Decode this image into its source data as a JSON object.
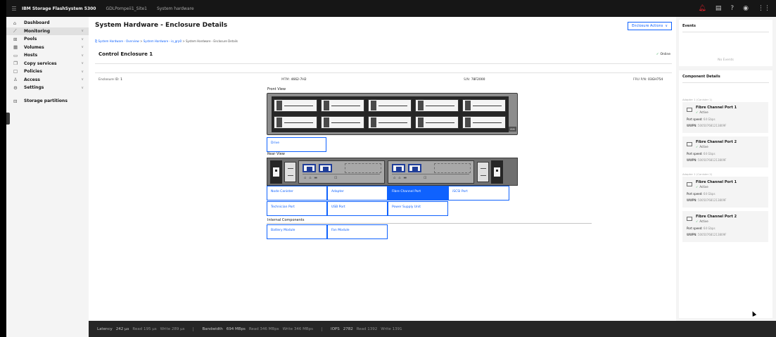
{
  "app": {
    "product": "IBM Storage FlashSystem 5300",
    "system": "GDLPompeii1_Site1",
    "section": "System hardware"
  },
  "topbar_icons": [
    "menu-icon",
    "notification-icon",
    "clipboard-icon",
    "help-icon",
    "user-icon",
    "app-switcher-icon"
  ],
  "nav": [
    {
      "label": "Dashboard",
      "icon": "dashboard-icon",
      "expandable": false
    },
    {
      "label": "Monitoring",
      "icon": "monitoring-icon",
      "expandable": true,
      "active": true
    },
    {
      "label": "Pools",
      "icon": "pools-icon",
      "expandable": true
    },
    {
      "label": "Volumes",
      "icon": "volumes-icon",
      "expandable": true
    },
    {
      "label": "Hosts",
      "icon": "hosts-icon",
      "expandable": true
    },
    {
      "label": "Copy services",
      "icon": "copy-services-icon",
      "expandable": true
    },
    {
      "label": "Policies",
      "icon": "policies-icon",
      "expandable": true
    },
    {
      "label": "Access",
      "icon": "access-icon",
      "expandable": true
    },
    {
      "label": "Settings",
      "icon": "settings-icon",
      "expandable": true
    }
  ],
  "partitions_label": "Storage partitions",
  "page": {
    "title": "System Hardware - Enclosure Details",
    "actions_label": "Enclosure Actions",
    "breadcrumb": [
      "System Hardware - Overview",
      "System Hardware - io_grp0",
      "System Hardware - Enclosure Details"
    ],
    "enclosure_title": "Control Enclosure 1",
    "status": "Online",
    "info": {
      "enclosure_id_label": "Enclosure ID:",
      "enclosure_id": "1",
      "mtm_label": "MTM:",
      "mtm": "4662-7H2",
      "sn_label": "S/N:",
      "sn": "78F2000",
      "fru_label": "FRU P/N:",
      "fru": "03GH754"
    }
  },
  "front_view_label": "Front View",
  "front_badge": "IBM",
  "drive_button": "Drive",
  "rear_view_label": "Rear View",
  "rear_buttons": [
    "Node Canister",
    "Adapter",
    "Fibre Channel Port",
    "iSCSI Port",
    "Technician Port",
    "USB Port",
    "Power Supply Unit"
  ],
  "rear_selected": "Fibre Channel Port",
  "internal_label": "Internal Components",
  "internal_buttons": [
    "Battery Module",
    "Fan Module"
  ],
  "events": {
    "title": "Events",
    "empty": "No Events"
  },
  "component_details": {
    "title": "Component Details",
    "groups": [
      {
        "label": "Adapter 1 (Canister 1)",
        "ports": [
          {
            "name": "Fibre Channel Port 1",
            "status": "Active",
            "speed_label": "Port speed:",
            "speed": "64 Gbps",
            "wwpn_label": "WWPN:",
            "wwpn": "500507681213809F"
          },
          {
            "name": "Fibre Channel Port 2",
            "status": "Active",
            "speed_label": "Port speed:",
            "speed": "64 Gbps",
            "wwpn_label": "WWPN:",
            "wwpn": "500507681213809F"
          }
        ]
      },
      {
        "label": "Adapter 1 (Canister 2)",
        "ports": [
          {
            "name": "Fibre Channel Port 1",
            "status": "Active",
            "speed_label": "Port speed:",
            "speed": "64 Gbps",
            "wwpn_label": "WWPN:",
            "wwpn": "500507681213809F"
          },
          {
            "name": "Fibre Channel Port 2",
            "status": "Active",
            "speed_label": "Port speed:",
            "speed": "64 Gbps",
            "wwpn_label": "WWPN:",
            "wwpn": "500507681213809F"
          }
        ]
      }
    ]
  },
  "statusbar": {
    "latency_label": "Latency",
    "latency": "242 µs",
    "latency_read": "Read 195 µs",
    "latency_write": "Write 289 µs",
    "bandwidth_label": "Bandwidth",
    "bandwidth": "694 MBps",
    "bandwidth_read": "Read 346 MBps",
    "bandwidth_write": "Write 346 MBps",
    "iops_label": "IOPS",
    "iops": "2782",
    "iops_read": "Read 1392",
    "iops_write": "Write 1391"
  }
}
